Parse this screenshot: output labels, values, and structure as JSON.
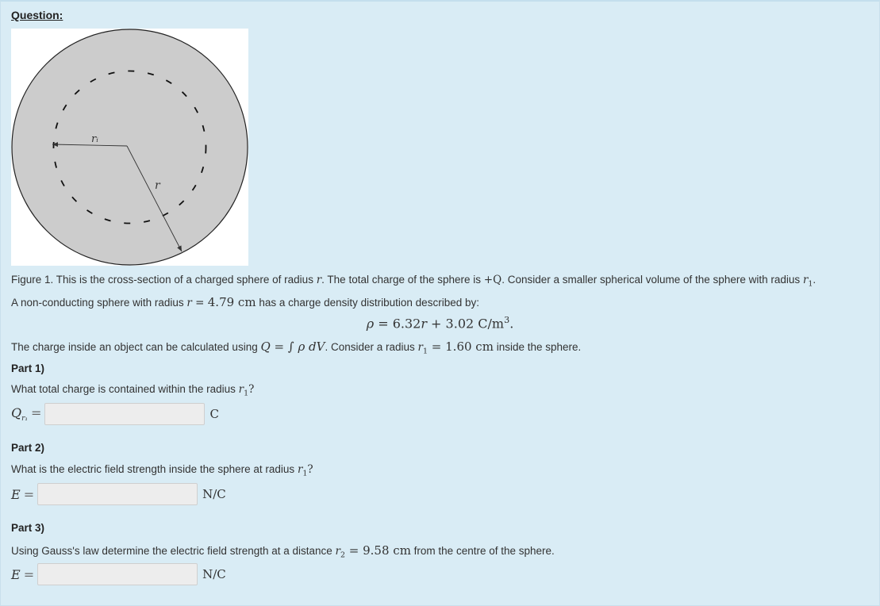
{
  "question_heading": "Question:",
  "figure": {
    "label_ri": "rᵢ",
    "label_r": "r"
  },
  "caption": {
    "text_a": "Figure 1. This is the cross-section of a charged sphere of radius ",
    "var_r": "r",
    "text_b": ". The total charge of the sphere is ",
    "charge": "+Q",
    "text_c": ". Consider a smaller spherical volume of the sphere with radius ",
    "var_r1": "r",
    "var_r1_sub": "1",
    "text_d": "."
  },
  "intro": {
    "text_a": "A non-conducting sphere with radius ",
    "var": "r",
    "eq": " = ",
    "value": "4.79 cm",
    "text_b": " has a charge density distribution described by:"
  },
  "density_formula": {
    "rho": "ρ",
    "eq": " = 6.32",
    "r": "r",
    "rest": " + 3.02 C/m",
    "sup": "3",
    "end": "."
  },
  "charge_line": {
    "text_a": "The charge inside an object can be calculated using ",
    "formula": "Q = ∫ ρ dV",
    "text_b": ". Consider a radius ",
    "var": "r",
    "var_sub": "1",
    "value": " = 1.60 cm",
    "text_c": " inside the sphere."
  },
  "part1": {
    "title": "Part 1)",
    "question_a": "What total charge is contained within the radius ",
    "var": "r",
    "var_sub": "1",
    "question_b": "?",
    "label": "Q",
    "label_sub": "r₁",
    "eq": "=",
    "input_value": "",
    "unit": "C"
  },
  "part2": {
    "title": "Part 2)",
    "question_a": "What is the electric field strength inside the sphere at radius ",
    "var": "r",
    "var_sub": "1",
    "question_b": "?",
    "label": "E",
    "eq": "=",
    "input_value": "",
    "unit": "N/C"
  },
  "part3": {
    "title": "Part 3)",
    "question_a": "Using Gauss's law determine the electric field strength at a distance ",
    "var": "r",
    "var_sub": "2",
    "value": " = 9.58 cm",
    "question_b": " from the centre of the sphere.",
    "label": "E",
    "eq": "=",
    "input_value": "",
    "unit": "N/C"
  }
}
